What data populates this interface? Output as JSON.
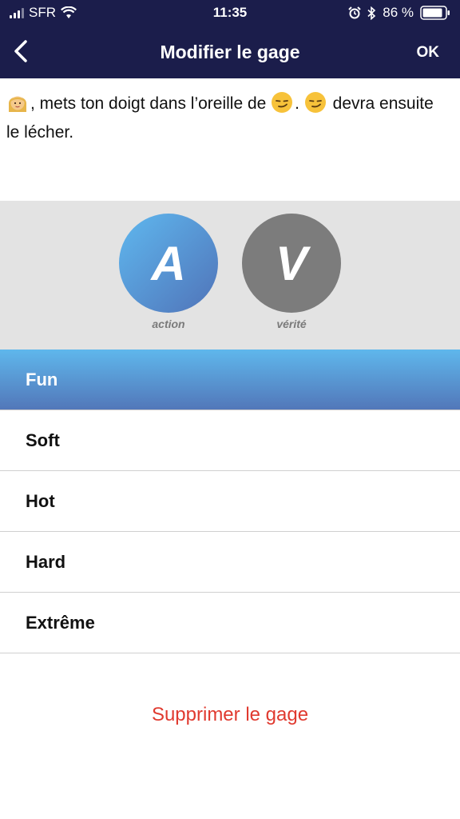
{
  "status_bar": {
    "carrier": "SFR",
    "time": "11:35",
    "battery": "86 %",
    "icons": [
      "signal-icon",
      "wifi-icon",
      "alarm-icon",
      "bluetooth-icon",
      "battery-icon"
    ]
  },
  "nav": {
    "back_icon": "chevron-left-icon",
    "title": "Modifier le gage",
    "ok_label": "OK"
  },
  "message": {
    "part1": ", mets ton doigt dans l’oreille de ",
    "part2": ". ",
    "part3": " devra ensuite le lécher.",
    "emojis": [
      "woman-emoji",
      "smirk-emoji",
      "smirk-emoji"
    ]
  },
  "type_selector": {
    "action": {
      "letter": "A",
      "label": "action",
      "color": "#5fb8ef"
    },
    "verite": {
      "letter": "V",
      "label": "vérité",
      "color": "#7c7c7c"
    }
  },
  "levels": [
    {
      "label": "Fun",
      "selected": true
    },
    {
      "label": "Soft",
      "selected": false
    },
    {
      "label": "Hot",
      "selected": false
    },
    {
      "label": "Hard",
      "selected": false
    },
    {
      "label": "Extrême",
      "selected": false
    }
  ],
  "delete_label": "Supprimer le gage",
  "colors": {
    "header_bg": "#1b1d4b",
    "accent_blue": "#5fb7ec",
    "delete_red": "#e03a2f"
  }
}
